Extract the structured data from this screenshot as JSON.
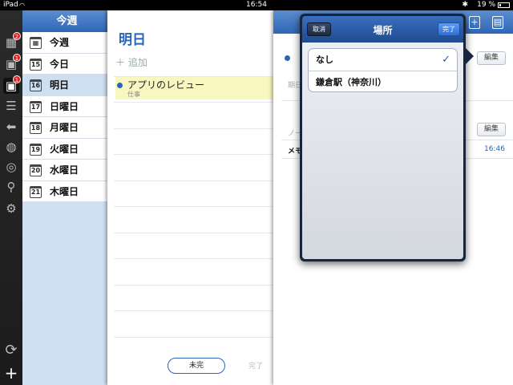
{
  "status_bar": {
    "device": "iPad",
    "time": "16:54",
    "battery": "19 %"
  },
  "rail": {
    "items": [
      {
        "icon": "calendar-week-icon",
        "badge": "2"
      },
      {
        "icon": "calendar-today-icon",
        "badge": "1"
      },
      {
        "icon": "calendar-tomorrow-icon",
        "badge": "1"
      },
      {
        "icon": "list-icon",
        "badge": ""
      },
      {
        "icon": "tag-icon",
        "badge": ""
      },
      {
        "icon": "globe-icon",
        "badge": ""
      },
      {
        "icon": "compass-icon",
        "badge": ""
      },
      {
        "icon": "search-icon",
        "badge": ""
      },
      {
        "icon": "gear-icon",
        "badge": ""
      }
    ],
    "bottom": [
      {
        "icon": "sync-icon"
      },
      {
        "icon": "plus-icon"
      }
    ]
  },
  "list": {
    "header": "今週",
    "rows": [
      {
        "label": "今週",
        "day": "",
        "selected": false
      },
      {
        "label": "今日",
        "day": "15",
        "selected": false
      },
      {
        "label": "明日",
        "day": "16",
        "selected": true
      },
      {
        "label": "日曜日",
        "day": "17",
        "selected": false
      },
      {
        "label": "月曜日",
        "day": "18",
        "selected": false
      },
      {
        "label": "火曜日",
        "day": "19",
        "selected": false
      },
      {
        "label": "水曜日",
        "day": "20",
        "selected": false
      },
      {
        "label": "木曜日",
        "day": "21",
        "selected": false
      }
    ]
  },
  "tasks": {
    "title": "明日",
    "add_label": "追加",
    "item": {
      "name": "アプリのレビュー",
      "category": "仕事"
    },
    "filter_label": "未完",
    "done_label": "完了"
  },
  "detail": {
    "edit_label": "編集",
    "date_faint": "期日",
    "note_faint": "ノー",
    "memo_label": "メモ",
    "memo_time": "16:46"
  },
  "popover": {
    "title": "場所",
    "cancel_label": "取消",
    "ok_label": "完了",
    "options": [
      {
        "label": "なし",
        "checked": true
      },
      {
        "label": "鎌倉駅（神奈川）",
        "checked": false
      }
    ],
    "accent": "#2a64b8"
  }
}
